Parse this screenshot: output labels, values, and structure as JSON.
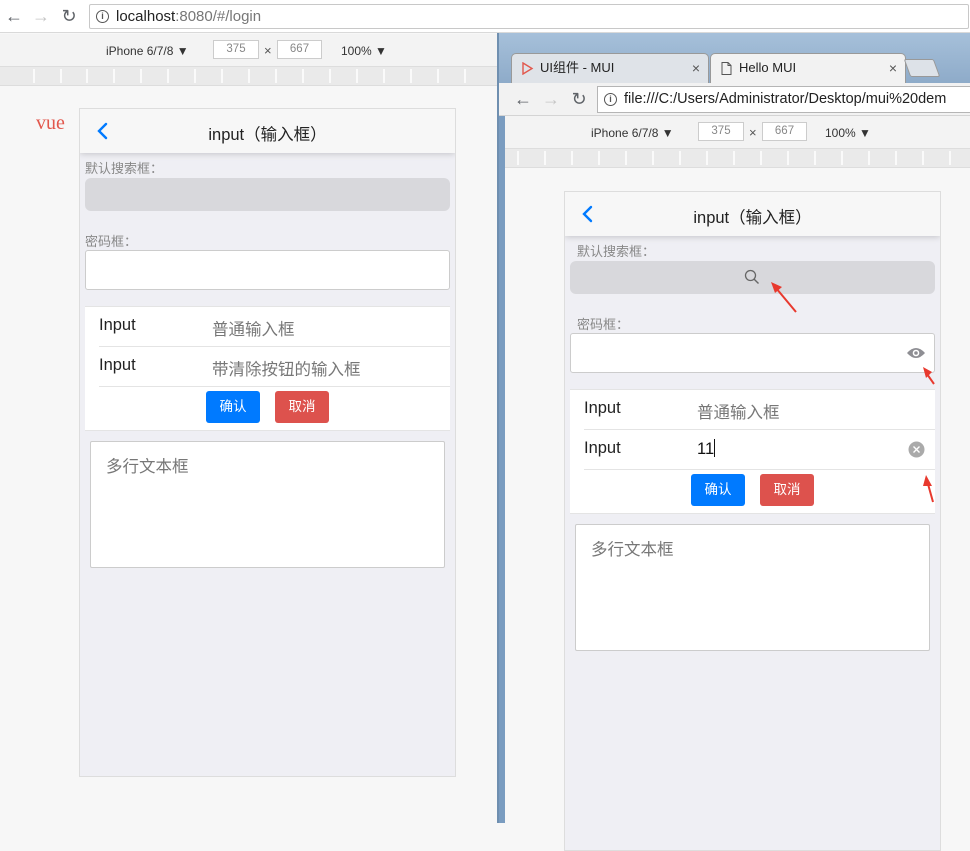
{
  "left_browser": {
    "url_host": "localhost",
    "url_rest": ":8080/#/login",
    "device": "iPhone 6/7/8",
    "width": "375",
    "height": "667",
    "zoom": "100%",
    "dim_separator": "×",
    "side_label": "vue"
  },
  "left_phone": {
    "title": "input（输入框）",
    "search_label": "默认搜索框：",
    "password_label": "密码框：",
    "rows": [
      {
        "label": "Input",
        "placeholder": "普通输入框"
      },
      {
        "label": "Input",
        "placeholder": "带清除按钮的输入框"
      }
    ],
    "confirm_label": "确认",
    "cancel_label": "取消",
    "textarea_placeholder": "多行文本框"
  },
  "right_window": {
    "tabs": [
      {
        "label": "UI组件 - MUI",
        "close": "×"
      },
      {
        "label": "Hello MUI",
        "close": "×"
      }
    ],
    "url": "file:///C:/Users/Administrator/Desktop/mui%20dem",
    "device": "iPhone 6/7/8",
    "width": "375",
    "height": "667",
    "zoom": "100%",
    "dim_separator": "×"
  },
  "right_phone": {
    "title": "input（输入框）",
    "search_label": "默认搜索框：",
    "password_label": "密码框：",
    "rows": [
      {
        "label": "Input",
        "value": "普通输入框"
      },
      {
        "label": "Input",
        "value": "11"
      }
    ],
    "confirm_label": "确认",
    "cancel_label": "取消",
    "textarea_placeholder": "多行文本框"
  },
  "colors": {
    "primary": "#007aff",
    "danger": "#dd524d",
    "annotation": "#e8392e"
  }
}
